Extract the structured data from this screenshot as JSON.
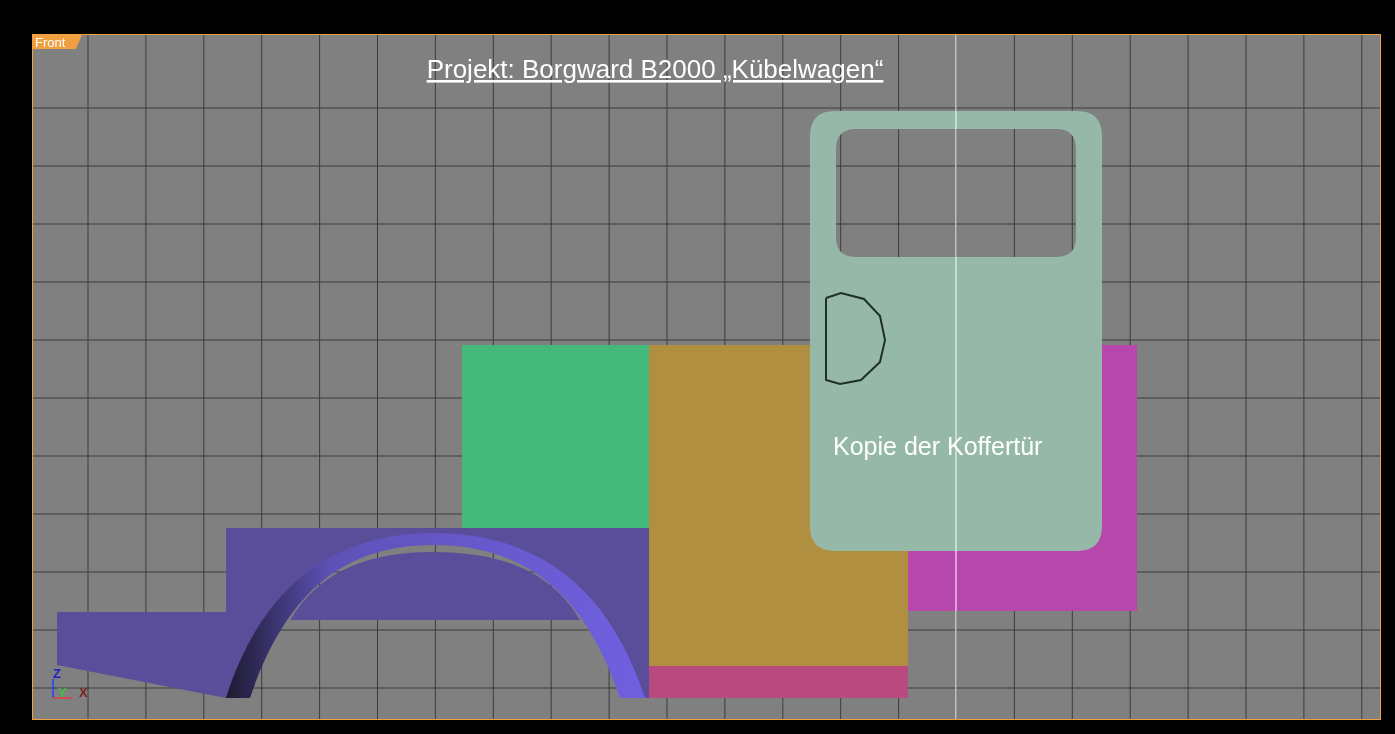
{
  "viewport": {
    "label": "Front",
    "title": "Projekt: Borgward B2000 „Kübelwagen“",
    "annotation": "Kopie der Koffertür",
    "axes": [
      {
        "kind": "z",
        "label": "Z"
      },
      {
        "kind": "y",
        "label": "Y"
      },
      {
        "kind": "x",
        "label": "X"
      }
    ]
  }
}
